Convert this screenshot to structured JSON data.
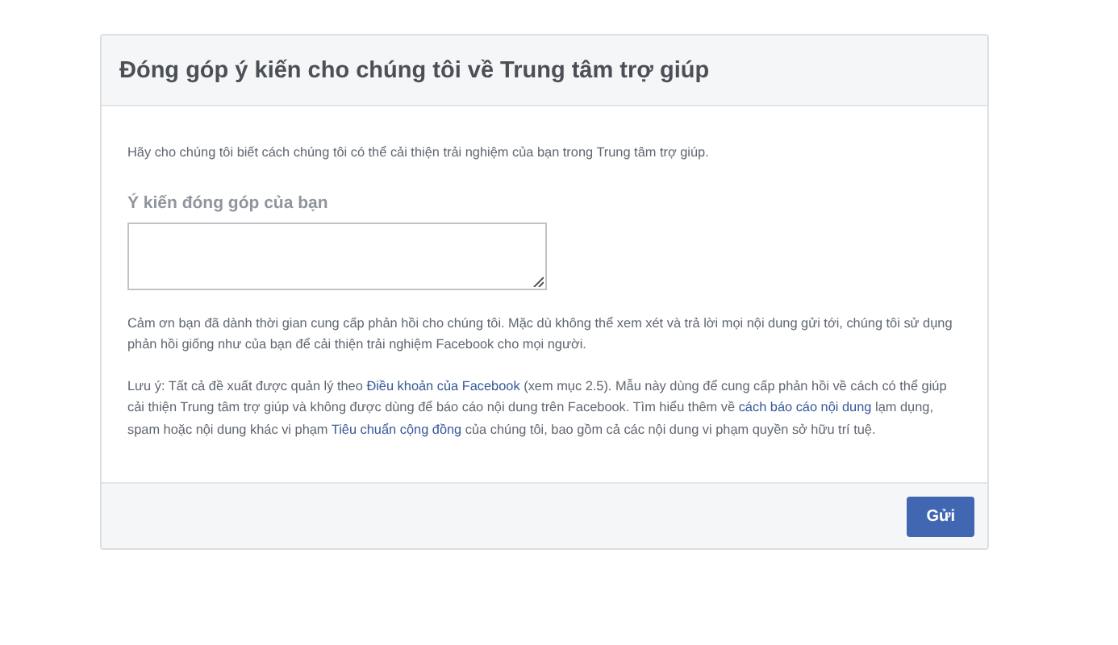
{
  "dialog": {
    "title": "Đóng góp ý kiến cho chúng tôi về Trung tâm trợ giúp",
    "intro": "Hãy cho chúng tôi biết cách chúng tôi có thể cải thiện trải nghiệm của bạn trong Trung tâm trợ giúp.",
    "feedback_field": {
      "label": "Ý kiến đóng góp của bạn"
    },
    "thanks": "Cảm ơn bạn đã dành thời gian cung cấp phản hồi cho chúng tôi. Mặc dù không thể xem xét và trả lời mọi nội dung gửi tới, chúng tôi sử dụng phản hồi giống như của bạn để cải thiện trải nghiệm Facebook cho mọi người.",
    "note": [
      {
        "kind": "text",
        "text": "Lưu ý: Tất cả đề xuất được quản lý theo "
      },
      {
        "kind": "link",
        "text": "Điều khoản của Facebook"
      },
      {
        "kind": "text",
        "text": " (xem mục 2.5). Mẫu này dùng để cung cấp phản hồi về cách có thể giúp cải thiện Trung tâm trợ giúp và không được dùng để báo cáo nội dung trên Facebook. Tìm hiểu thêm về "
      },
      {
        "kind": "link",
        "text": "cách báo cáo nội dung"
      },
      {
        "kind": "text",
        "text": " lạm dụng, spam hoặc nội dung khác vi phạm "
      },
      {
        "kind": "link",
        "text": "Tiêu chuẩn cộng đồng"
      },
      {
        "kind": "text",
        "text": " của chúng tôi, bao gồm cả các nội dung vi phạm quyền sở hữu trí tuệ."
      }
    ],
    "submit_button": "Gửi"
  }
}
